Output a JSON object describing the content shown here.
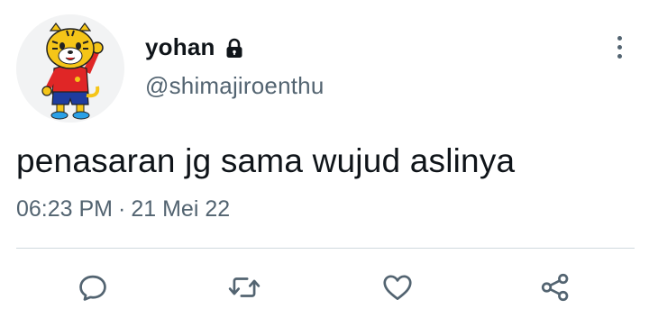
{
  "tweet": {
    "author": {
      "display_name": "yohan",
      "handle": "@shimajiroenthu",
      "protected_icon": "lock-icon",
      "avatar": "cartoon-tiger-avatar"
    },
    "text": "penasaran jg sama wujud aslinya",
    "time": "06:23 PM",
    "separator": "·",
    "date": "21 Mei 22"
  },
  "actions": [
    {
      "name": "reply",
      "icon": "reply-icon"
    },
    {
      "name": "retweet",
      "icon": "retweet-icon"
    },
    {
      "name": "like",
      "icon": "heart-icon"
    },
    {
      "name": "share",
      "icon": "share-icon"
    }
  ],
  "colors": {
    "text_primary": "#0f1419",
    "text_secondary": "#536471",
    "divider": "#cfd9de"
  }
}
